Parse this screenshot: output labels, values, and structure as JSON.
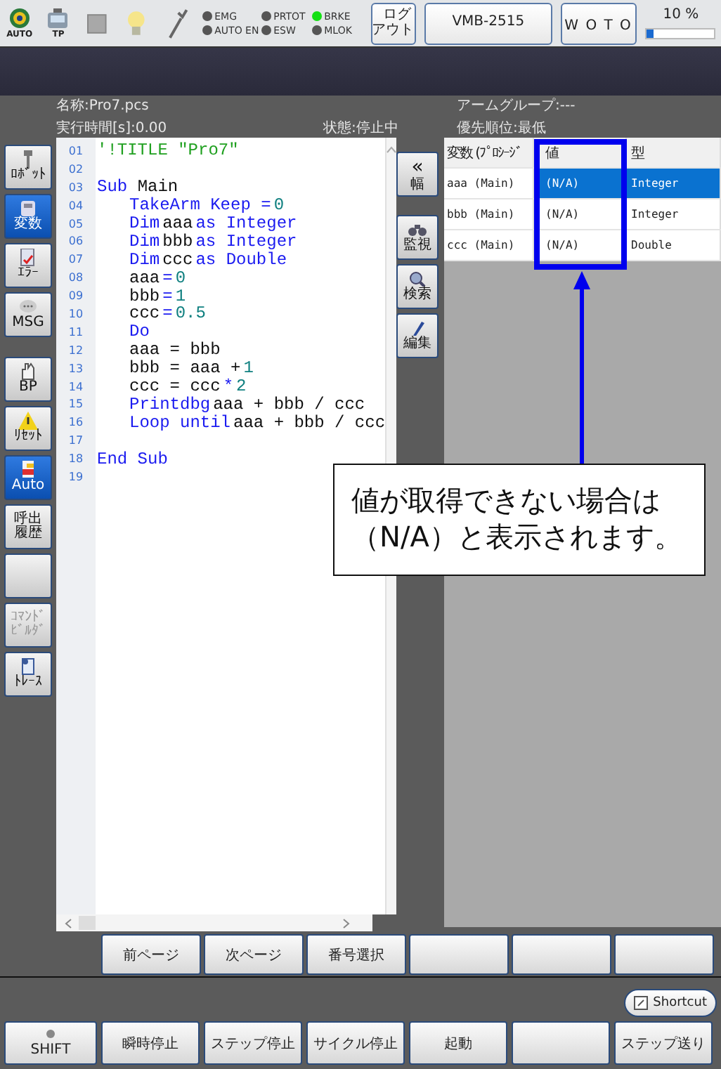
{
  "top_bar": {
    "mode_icons": [
      {
        "label": "AUTO"
      },
      {
        "label": "TP"
      }
    ],
    "indicators": [
      {
        "label": "EMG",
        "on": false
      },
      {
        "label": "PRTOT",
        "on": false
      },
      {
        "label": "BRKE",
        "on": true
      },
      {
        "label": "AUTO EN",
        "on": false
      },
      {
        "label": "ESW",
        "on": false
      },
      {
        "label": "MLOK",
        "on": false
      }
    ],
    "logout_button": "ログアウト",
    "controller_button": "VMB-2515",
    "user_button": "W O T O",
    "speed": {
      "reading": "10 %",
      "level": 0.1
    }
  },
  "program_info": {
    "name": "名称:Pro7.pcs",
    "arm_group": "アームグループ:---",
    "exec_time": "実行時間[s]:0.00",
    "status": "状態:停止中",
    "priority": "優先順位:最低"
  },
  "sidebar": {
    "groups": [
      [
        {
          "kind": "label",
          "label": "ﾛﾎﾞｯﾄ",
          "selected": false,
          "disabled": false
        },
        {
          "kind": "label",
          "label": "変数",
          "selected": true,
          "disabled": false
        },
        {
          "kind": "label",
          "label": "ｴﾗｰ",
          "selected": false,
          "disabled": false
        },
        {
          "kind": "label",
          "label": "MSG",
          "selected": false,
          "disabled": false
        }
      ],
      [
        {
          "kind": "label",
          "label": "BP",
          "selected": false,
          "disabled": false
        },
        {
          "kind": "label",
          "label": "ﾘｾｯﾄ",
          "selected": false,
          "disabled": false
        },
        {
          "kind": "label",
          "label": "Auto",
          "selected": true,
          "disabled": false
        },
        {
          "kind": "label",
          "label": "呼出履歴",
          "selected": false,
          "disabled": false
        },
        {
          "kind": "blank",
          "selected": false,
          "disabled": false
        },
        {
          "kind": "label",
          "label": "ｺﾏﾝﾄﾞﾋﾞﾙﾀﾞ",
          "selected": false,
          "disabled": true
        },
        {
          "kind": "label",
          "label": "ﾄﾚｰｽ",
          "selected": false,
          "disabled": false
        }
      ]
    ]
  },
  "editor": {
    "lines": [
      {
        "number": "01",
        "indented": false,
        "tokens": [
          {
            "kind": "comment",
            "text": "'!TITLE \"Pro7\""
          }
        ]
      },
      {
        "number": "02"
      },
      {
        "number": "03",
        "indented": false,
        "tokens": [
          {
            "kind": "keyword",
            "text": "Sub"
          },
          {
            "kind": "ident",
            "text": "Main"
          }
        ]
      },
      {
        "number": "04",
        "indented": true,
        "tokens": [
          {
            "kind": "keyword",
            "text": "TakeArm Keep ="
          },
          {
            "kind": "number",
            "text": "0"
          }
        ]
      },
      {
        "number": "05",
        "indented": true,
        "tokens": [
          {
            "kind": "keyword",
            "text": "Dim"
          },
          {
            "kind": "ident",
            "text": "aaa"
          },
          {
            "kind": "keyword",
            "text": "as Integer"
          }
        ]
      },
      {
        "number": "06",
        "indented": true,
        "tokens": [
          {
            "kind": "keyword",
            "text": "Dim"
          },
          {
            "kind": "ident",
            "text": "bbb"
          },
          {
            "kind": "keyword",
            "text": "as Integer"
          }
        ]
      },
      {
        "number": "07",
        "indented": true,
        "tokens": [
          {
            "kind": "keyword",
            "text": "Dim"
          },
          {
            "kind": "ident",
            "text": "ccc"
          },
          {
            "kind": "keyword",
            "text": "as Double"
          }
        ]
      },
      {
        "number": "08",
        "indented": true,
        "tokens": [
          {
            "kind": "ident",
            "text": "aaa"
          },
          {
            "kind": "keyword",
            "text": "="
          },
          {
            "kind": "number",
            "text": "0"
          }
        ]
      },
      {
        "number": "09",
        "indented": true,
        "tokens": [
          {
            "kind": "ident",
            "text": "bbb"
          },
          {
            "kind": "keyword",
            "text": "="
          },
          {
            "kind": "number",
            "text": "1"
          }
        ]
      },
      {
        "number": "10",
        "indented": true,
        "tokens": [
          {
            "kind": "ident",
            "text": "ccc"
          },
          {
            "kind": "keyword",
            "text": "="
          },
          {
            "kind": "number",
            "text": "0.5"
          }
        ]
      },
      {
        "number": "11",
        "indented": true,
        "tokens": [
          {
            "kind": "keyword",
            "text": "Do"
          }
        ]
      },
      {
        "number": "12",
        "indented": true,
        "tokens": [
          {
            "kind": "ident",
            "text": "aaa = bbb"
          }
        ]
      },
      {
        "number": "13",
        "indented": true,
        "tokens": [
          {
            "kind": "ident",
            "text": "bbb = aaa +"
          },
          {
            "kind": "number",
            "text": "1"
          }
        ]
      },
      {
        "number": "14",
        "indented": true,
        "tokens": [
          {
            "kind": "ident",
            "text": "ccc = ccc"
          },
          {
            "kind": "keyword",
            "text": "*"
          },
          {
            "kind": "number",
            "text": "2"
          }
        ]
      },
      {
        "number": "15",
        "indented": true,
        "tokens": [
          {
            "kind": "keyword",
            "text": "Printdbg"
          },
          {
            "kind": "ident",
            "text": "aaa + bbb / ccc"
          }
        ]
      },
      {
        "number": "16",
        "indented": true,
        "tokens": [
          {
            "kind": "keyword",
            "text": "Loop until"
          },
          {
            "kind": "ident",
            "text": "aaa + bbb / ccc"
          }
        ]
      },
      {
        "number": "17"
      },
      {
        "number": "18",
        "indented": false,
        "tokens": [
          {
            "kind": "keyword",
            "text": "End Sub"
          }
        ]
      },
      {
        "number": "19"
      }
    ]
  },
  "side_tools": [
    {
      "glyph": "«",
      "label": "幅"
    },
    {
      "label": "監視"
    },
    {
      "label": "検索"
    },
    {
      "label": "編集"
    }
  ],
  "variables_table": {
    "columns": [
      "変数 (ﾌﾟﾛｼｰｼﾞ",
      "値",
      "型"
    ],
    "rows": [
      {
        "cells": [
          "aaa (Main)",
          "(N/A)",
          "Integer"
        ],
        "selected": true
      },
      {
        "cells": [
          "bbb (Main)",
          "(N/A)",
          "Integer"
        ],
        "selected": false
      },
      {
        "cells": [
          "ccc (Main)",
          "(N/A)",
          "Double"
        ],
        "selected": false
      }
    ]
  },
  "annotation": {
    "callout": "値が取得できない場合は（N/A）と表示されます。"
  },
  "page_buttons": [
    {
      "kind": "label",
      "label": "前ページ"
    },
    {
      "kind": "label",
      "label": "次ページ"
    },
    {
      "kind": "label",
      "label": "番号選択"
    },
    {
      "kind": "blank"
    },
    {
      "kind": "blank"
    },
    {
      "kind": "blank"
    }
  ],
  "shortcut_button": {
    "label": "Shortcut"
  },
  "action_buttons": [
    {
      "kind": "shift",
      "label": "SHIFT",
      "on": false
    },
    {
      "kind": "label",
      "label": "瞬時停止"
    },
    {
      "kind": "label",
      "label": "ステップ停止"
    },
    {
      "kind": "label",
      "label": "サイクル停止"
    },
    {
      "kind": "label",
      "label": "起動"
    },
    {
      "kind": "blank"
    },
    {
      "kind": "label",
      "label": "ステップ送り"
    }
  ]
}
